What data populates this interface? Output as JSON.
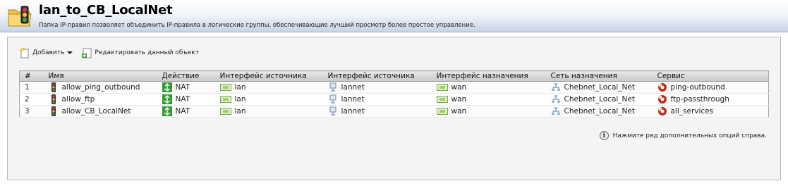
{
  "header": {
    "title": "lan_to_CB_LocalNet",
    "subtitle": "Папка IP-правил позволяет объединить IP-правила в логические группы, обеспечивающие лучший просмотр более простое управление."
  },
  "toolbar": {
    "add_label": "Добавить",
    "edit_label": "Редактировать данный объект"
  },
  "table": {
    "columns": [
      "#",
      "Имя",
      "Действие",
      "Интерфейс источника",
      "Интерфейс источника",
      "Интерфейс назначения",
      "Сеть назначения",
      "Сервис"
    ],
    "rows": [
      {
        "num": "1",
        "name": "allow_ping_outbound",
        "action": "NAT",
        "src_if": "lan",
        "src_net": "lannet",
        "dst_if": "wan",
        "dst_net": "Chebnet_Local_Net",
        "service": "ping-outbound"
      },
      {
        "num": "2",
        "name": "allow_ftp",
        "action": "NAT",
        "src_if": "lan",
        "src_net": "lannet",
        "dst_if": "wan",
        "dst_net": "Chebnet_Local_Net",
        "service": "ftp-passthrough"
      },
      {
        "num": "3",
        "name": "allow_CB_LocalNet",
        "action": "NAT",
        "src_if": "lan",
        "src_net": "lannet",
        "dst_if": "wan",
        "dst_net": "Chebnet_Local_Net",
        "service": "all_services"
      }
    ]
  },
  "info_text": "Нажмите ряд дополнительных опций справа.",
  "icons": {
    "header": "folder-traffic-light-icon",
    "rule": "traffic-light-icon",
    "action": "nat-icon",
    "interface": "ethernet-port-icon",
    "network": "network-address-icon",
    "destination_net": "network-tree-icon",
    "service": "service-gear-icon"
  },
  "colors": {
    "header_gradient_end": "#c7d3e6",
    "nat_green": "#2f9d2f",
    "service_red": "#c8281e"
  }
}
